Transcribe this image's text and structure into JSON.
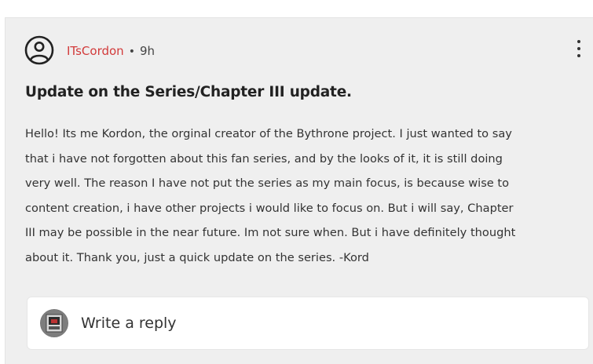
{
  "post": {
    "username": "ITsCordon",
    "separator": "•",
    "time_ago": "9h",
    "title": "Update on the Series/Chapter III update.",
    "body_lines": [
      "Hello! Its me Kordon, the orginal creator of the Bythrone project. I just wanted to say",
      "that i have not forgotten about this fan series, and by the looks of it, it is still doing",
      "very well. The reason I have not put the series as my main focus, is because wise to",
      "content creation, i have other projects i would like to focus on. But i will say, Chapter",
      "III may be possible in the near future. Im not sure when. But i have definitely thought",
      "about it. Thank you, just a quick update on the series. -Kord"
    ],
    "author_avatar_icon": "user-circle-icon",
    "menu_icon": "kebab-menu-icon"
  },
  "reply": {
    "placeholder": "Write a reply",
    "avatar_icon": "user-avatar-icon"
  },
  "colors": {
    "username": "#d23a3a",
    "card_background": "#efefef",
    "text": "#333333"
  }
}
